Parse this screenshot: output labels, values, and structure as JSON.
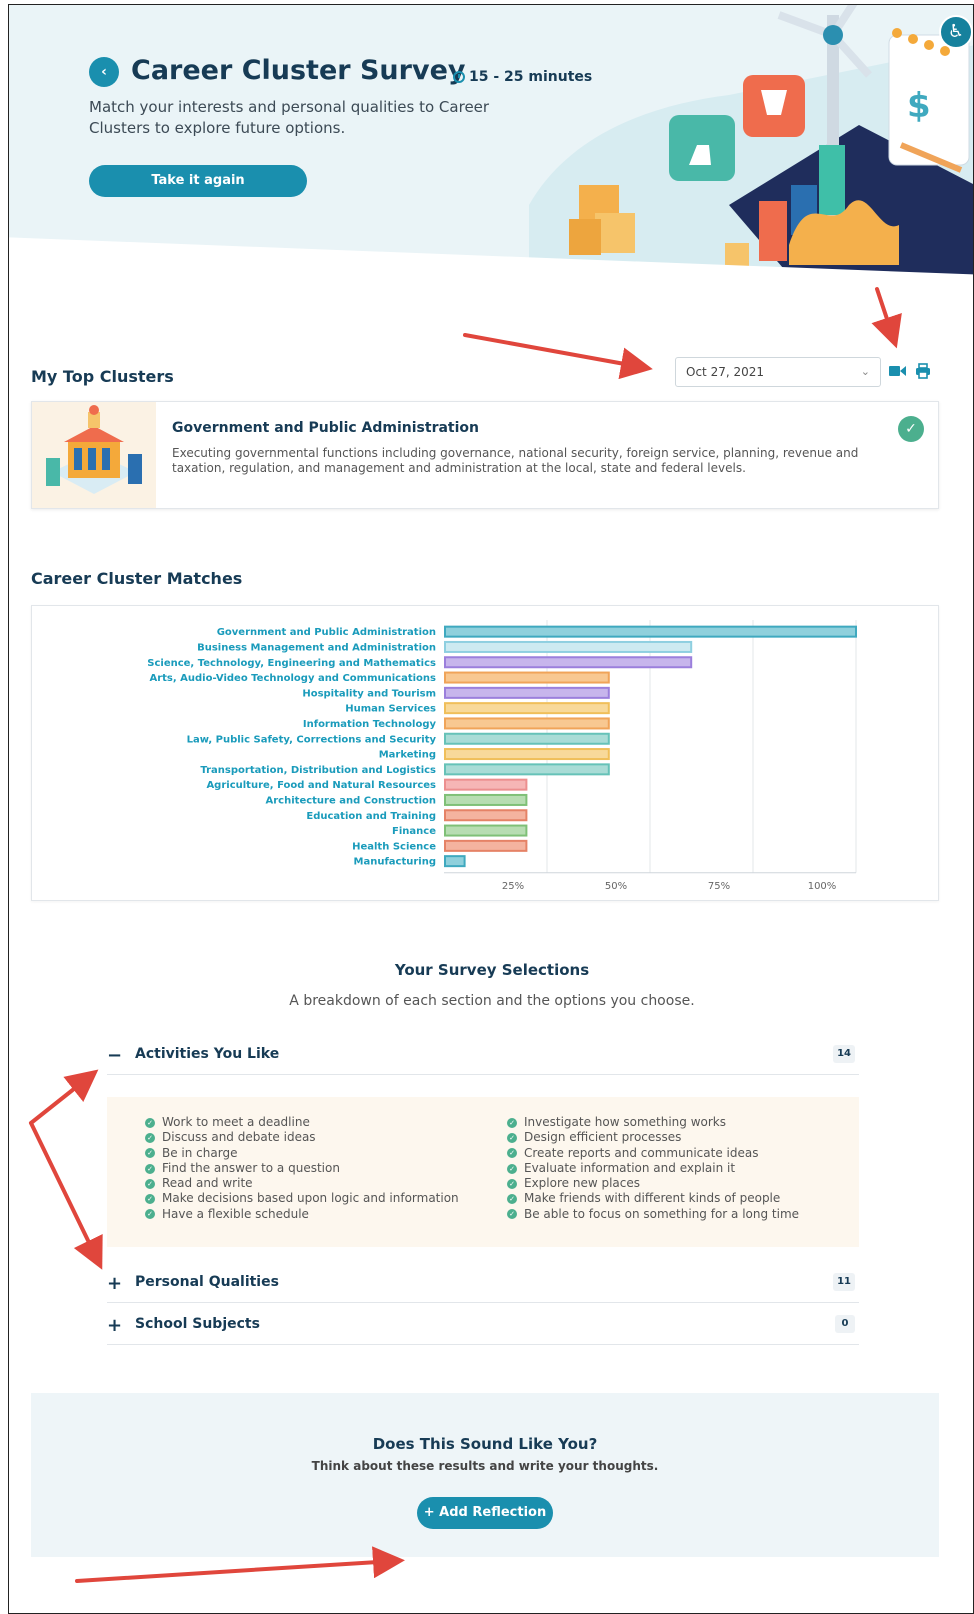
{
  "hero": {
    "back_icon": "chevron-left-icon",
    "title": "Career Cluster Survey",
    "duration": "15 - 25 minutes",
    "subtitle": "Match your interests and personal qualities to Career Clusters to explore future options.",
    "retake_label": "Take it again",
    "accessibility_icon": "accessibility-icon"
  },
  "top_clusters": {
    "title": "My Top Clusters",
    "date_value": "Oct 27, 2021",
    "video_icon": "video-camera-icon",
    "print_icon": "printer-icon",
    "card": {
      "name": "Government and Public Administration",
      "description": "Executing governmental functions including governance, national security, foreign service, planning, revenue and taxation, regulation, and management and administration at the local, state and federal levels."
    }
  },
  "matches": {
    "title": "Career Cluster Matches"
  },
  "chart_data": {
    "type": "bar",
    "orientation": "horizontal",
    "categories": [
      "Government and Public Administration",
      "Business Management and Administration",
      "Science, Technology, Engineering and Mathematics",
      "Arts, Audio-Video Technology and Communications",
      "Hospitality and Tourism",
      "Human Services",
      "Information Technology",
      "Law, Public Safety, Corrections and Security",
      "Marketing",
      "Transportation, Distribution and Logistics",
      "Agriculture, Food and Natural Resources",
      "Architecture and Construction",
      "Education and Training",
      "Finance",
      "Health Science",
      "Manufacturing"
    ],
    "values": [
      100,
      60,
      60,
      40,
      40,
      40,
      40,
      40,
      40,
      40,
      20,
      20,
      20,
      20,
      20,
      5
    ],
    "colors": [
      "#8fd0dc",
      "#cdeaf1",
      "#c7b5ec",
      "#f8c891",
      "#c7b5ec",
      "#f8d99a",
      "#f8c891",
      "#a9dcd6",
      "#f8d99a",
      "#a9dcd6",
      "#f6b6b6",
      "#b7ddb2",
      "#f4b39f",
      "#b7ddb2",
      "#f4b39f",
      "#8fd0dc"
    ],
    "borders": [
      "#3fa9bf",
      "#8ecfe0",
      "#9b7fdc",
      "#f0a459",
      "#9b7fdc",
      "#f0bf5a",
      "#f0a459",
      "#66c2b8",
      "#f0bf5a",
      "#66c2b8",
      "#ec8f8f",
      "#7fc077",
      "#e58266",
      "#7fc077",
      "#e58266",
      "#3fa9bf"
    ],
    "xticks": [
      "25%",
      "50%",
      "75%",
      "100%"
    ],
    "xlim": [
      0,
      100
    ],
    "grid": true,
    "label_color": "#1a9bbb"
  },
  "survey": {
    "title": "Your Survey Selections",
    "subtitle": "A breakdown of each section and the options you choose.",
    "sections": [
      {
        "sign": "−",
        "label": "Activities You Like",
        "count": "14"
      },
      {
        "sign": "+",
        "label": "Personal Qualities",
        "count": "11"
      },
      {
        "sign": "+",
        "label": "School Subjects",
        "count": "0"
      }
    ],
    "activities_left": [
      "Work to meet a deadline",
      "Discuss and debate ideas",
      "Be in charge",
      "Find the answer to a question",
      "Read and write",
      "Make decisions based upon logic and information",
      "Have a flexible schedule"
    ],
    "activities_right": [
      "Investigate how something works",
      "Design efficient processes",
      "Create reports and communicate ideas",
      "Evaluate information and explain it",
      "Explore new places",
      "Make friends with different kinds of people",
      "Be able to focus on something for a long time"
    ]
  },
  "reflection": {
    "title": "Does This Sound Like You?",
    "subtitle": "Think about these results and write your thoughts.",
    "button_label": "+ Add Reflection"
  },
  "colors": {
    "accent": "#1a8fae",
    "heading": "#173b55",
    "check": "#4caf8e",
    "arrow": "#e0463c"
  }
}
